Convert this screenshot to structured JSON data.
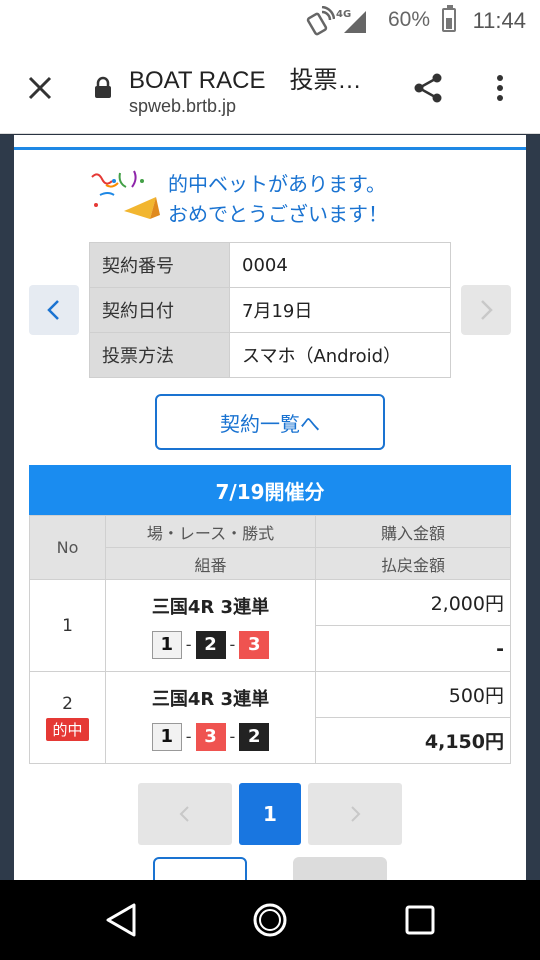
{
  "status_bar": {
    "network": "4G",
    "battery": "60%",
    "time": "11:44"
  },
  "browser": {
    "title": "BOAT RACE　投票…",
    "url": "spweb.brtb.jp"
  },
  "congrats": {
    "line1": "的中ベットがあります。",
    "line2": "おめでとうございます！"
  },
  "contract": {
    "rows": [
      {
        "label": "契約番号",
        "value": "0004"
      },
      {
        "label": "契約日付",
        "value": "7月19日"
      },
      {
        "label": "投票方法",
        "value": "スマホ（Android）"
      }
    ]
  },
  "list_button": "契約一覧へ",
  "date_header": "7/19開催分",
  "bets_table": {
    "headers": {
      "no": "No",
      "race": "場・レース・勝式",
      "purchase": "購入金額",
      "combo": "組番",
      "payout": "払戻金額"
    },
    "rows": [
      {
        "no": "1",
        "race": "三国4R 3連単",
        "combo": [
          "1",
          "2",
          "3"
        ],
        "purchase": "2,000円",
        "payout": "-",
        "hit": ""
      },
      {
        "no": "2",
        "race": "三国4R 3連単",
        "combo": [
          "1",
          "3",
          "2"
        ],
        "purchase": "500円",
        "payout": "4,150円",
        "hit": "的中"
      }
    ]
  },
  "pagination": {
    "current": "1"
  }
}
